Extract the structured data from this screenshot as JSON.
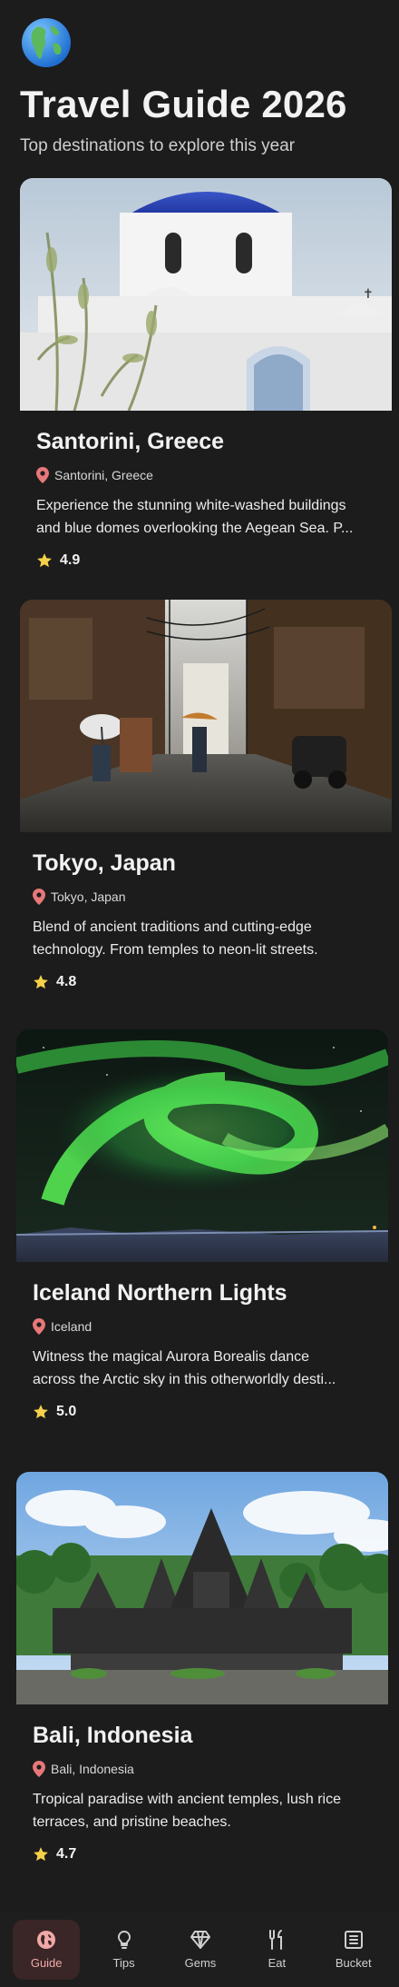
{
  "header": {
    "title": "Travel Guide 2026",
    "subtitle": "Top destinations to explore this year"
  },
  "destinations": [
    {
      "title": "Santorini, Greece",
      "location": "Santorini, Greece",
      "desc_line1": "Experience the stunning white-washed buildings",
      "desc_line2": "and blue domes overlooking the Aegean Sea. P...",
      "rating": "4.9"
    },
    {
      "title": "Tokyo, Japan",
      "location": "Tokyo, Japan",
      "desc_line1": "Blend of ancient traditions and cutting-edge",
      "desc_line2": "technology. From temples to neon-lit streets.",
      "rating": "4.8"
    },
    {
      "title": "Iceland Northern Lights",
      "location": "Iceland",
      "desc_line1": "Witness the magical Aurora Borealis dance",
      "desc_line2": "across the Arctic sky in this otherworldly desti...",
      "rating": "5.0"
    },
    {
      "title": "Bali, Indonesia",
      "location": "Bali, Indonesia",
      "desc_line1": "Tropical paradise with ancient temples, lush rice",
      "desc_line2": "terraces, and pristine beaches.",
      "rating": "4.7"
    }
  ],
  "tabs": [
    {
      "label": "Guide",
      "icon": "globe-icon",
      "active": true
    },
    {
      "label": "Tips",
      "icon": "lightbulb-icon",
      "active": false
    },
    {
      "label": "Gems",
      "icon": "gem-icon",
      "active": false
    },
    {
      "label": "Eat",
      "icon": "utensils-icon",
      "active": false
    },
    {
      "label": "Bucket",
      "icon": "list-icon",
      "active": false
    }
  ],
  "colors": {
    "background": "#1c1c1c",
    "accent": "#f2a8a8",
    "active_tab_bg": "#3a2626",
    "star": "#f5d14a",
    "pin": "#e8777a"
  }
}
